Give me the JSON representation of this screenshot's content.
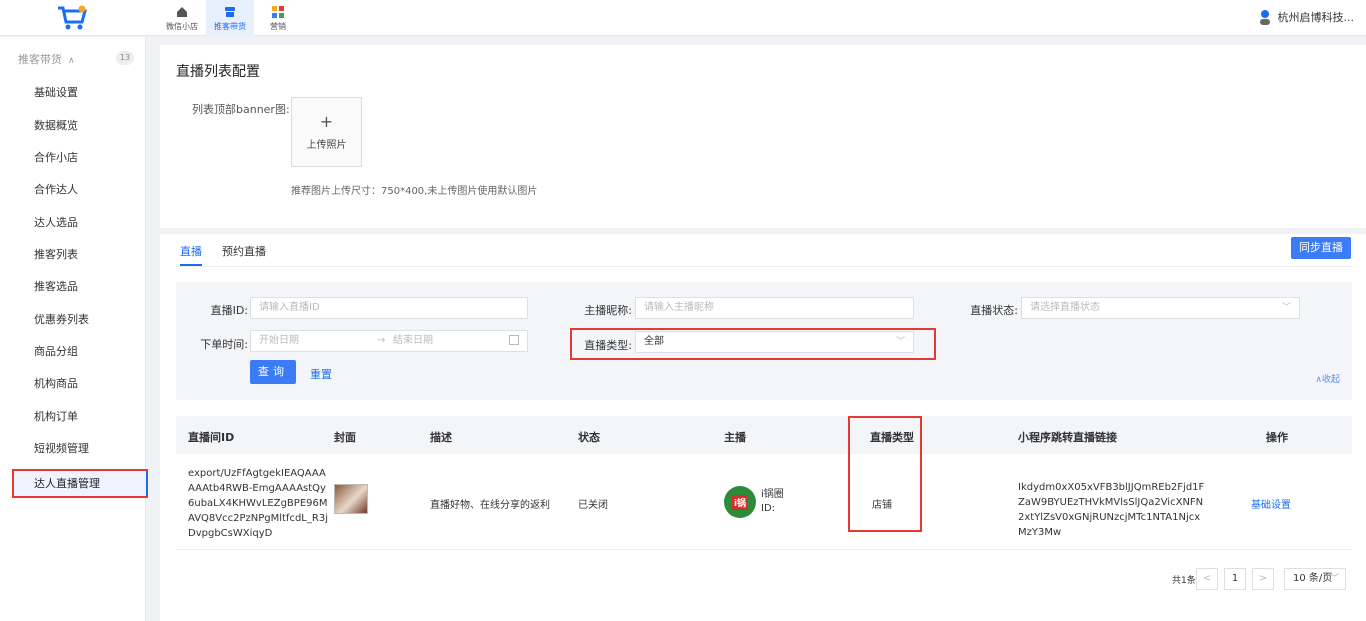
{
  "topbar": {
    "nav": [
      {
        "label": "微信小店",
        "icon": "home-icon"
      },
      {
        "label": "推客带货",
        "icon": "shop-icon"
      },
      {
        "label": "营销",
        "icon": "apps-icon"
      }
    ],
    "user_name": "杭州启博科技..."
  },
  "sidebar": {
    "group_title": "推客带货",
    "group_badge": "13",
    "items": [
      "基础设置",
      "数据概览",
      "合作小店",
      "合作达人",
      "达人选品",
      "推客列表",
      "推客选品",
      "优惠券列表",
      "商品分组",
      "机构商品",
      "机构订单",
      "短视频管理",
      "达人直播管理"
    ],
    "active_index": 12
  },
  "config_card": {
    "title": "直播列表配置",
    "banner_label": "列表顶部banner图:",
    "upload_plus": "+",
    "upload_text": "上传照片",
    "hint": "推荐图片上传尺寸：750*400,未上传图片使用默认图片"
  },
  "tabs": [
    "直播",
    "预约直播"
  ],
  "sync_button": "同步直播",
  "filters": {
    "live_id_label": "直播ID:",
    "live_id_placeholder": "请输入直播ID",
    "host_label": "主播昵称:",
    "host_placeholder": "请输入主播昵称",
    "status_label": "直播状态:",
    "status_placeholder": "请选择直播状态",
    "order_time_label": "下单时间:",
    "start_placeholder": "开始日期",
    "range_arrow": "→",
    "end_placeholder": "结束日期",
    "type_label": "直播类型:",
    "type_value": "全部",
    "query_button": "查询",
    "reset_button": "重置",
    "collapse": "∧收起"
  },
  "table": {
    "headers": [
      "直播间ID",
      "封面",
      "描述",
      "状态",
      "主播",
      "直播类型",
      "小程序跳转直播链接",
      "操作"
    ],
    "rows": [
      {
        "id": "export/UzFfAgtgekIEAQAAAAAAtb4RWB-EmgAAAAstQy6ubaLX4KHWvLEZgBPE96MAVQ8Vcc2PzNPgMltfcdL_R3jDvpgbCsWXiqyD",
        "description": "直播好物、在线分享的返利",
        "status": "已关闭",
        "host_name": "i锅圈",
        "host_id": "ID:",
        "live_type": "店铺",
        "link": "Ikdydm0xX05xVFB3blJJQmREb2Fjd1FZaW9BYUEzTHVkMVlsSlJQa2VicXNFN2xtYlZsV0xGNjRUNzcjMTc1NTA1NjcxMzY3Mw",
        "action": "基础设置"
      }
    ]
  },
  "pagination": {
    "total": "共1条",
    "prev": "<",
    "page": "1",
    "next": ">",
    "page_size": "10 条/页"
  },
  "colors": {
    "primary": "#1a6cf5",
    "highlight": "#e53935"
  }
}
